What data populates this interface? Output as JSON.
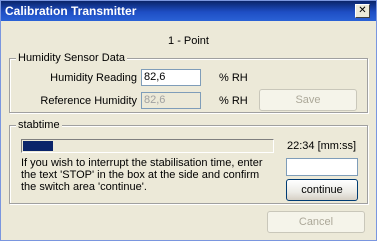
{
  "window": {
    "title": "Calibration Transmitter",
    "close_glyph": "✕"
  },
  "mode": "1 - Point",
  "humidity_group": {
    "title": "Humidity Sensor Data",
    "reading_label": "Humidity Reading",
    "reading_value": "82,6",
    "reading_unit": "% RH",
    "reference_label": "Reference Humidity",
    "reference_value": "82,6",
    "reference_unit": "% RH",
    "save_label": "Save"
  },
  "stabilisation_group": {
    "title": "stabtime",
    "progress_fraction": 0.12,
    "time_text": "22:34 [mm:ss]",
    "instructions": "If you wish to interrupt the stabilisation time, enter the text 'STOP' in the box at the side and confirm the switch area 'continue'.",
    "stop_input_value": "",
    "continue_label": "continue"
  },
  "cancel_label": "Cancel",
  "colors": {
    "title_bar": "#0a246a",
    "progress": "#0a246a",
    "dialog_bg": "#ece9d8"
  }
}
